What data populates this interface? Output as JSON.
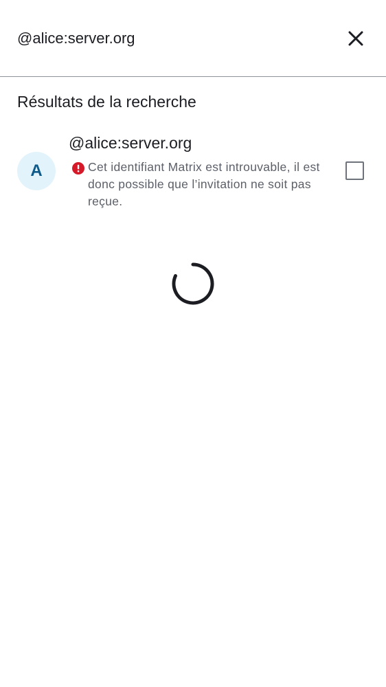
{
  "search": {
    "query": "@alice:server.org",
    "close_icon": "close-icon"
  },
  "results": {
    "section_title": "Résultats de la recherche",
    "items": [
      {
        "avatar_letter": "A",
        "name": "@alice:server.org",
        "warning_icon": "error-icon",
        "warning": "Cet identifiant Matrix est introuvable, il est donc possible que l’invitation ne soit pas reçue.",
        "selected": false
      }
    ]
  },
  "colors": {
    "avatar_background": "#e2f3fb",
    "avatar_text": "#0d5a8a",
    "error": "#d51928",
    "text_primary": "#1b1d22",
    "text_secondary": "#5b5f68",
    "divider": "#8d919a"
  },
  "loading": {
    "icon": "loading-spinner"
  }
}
